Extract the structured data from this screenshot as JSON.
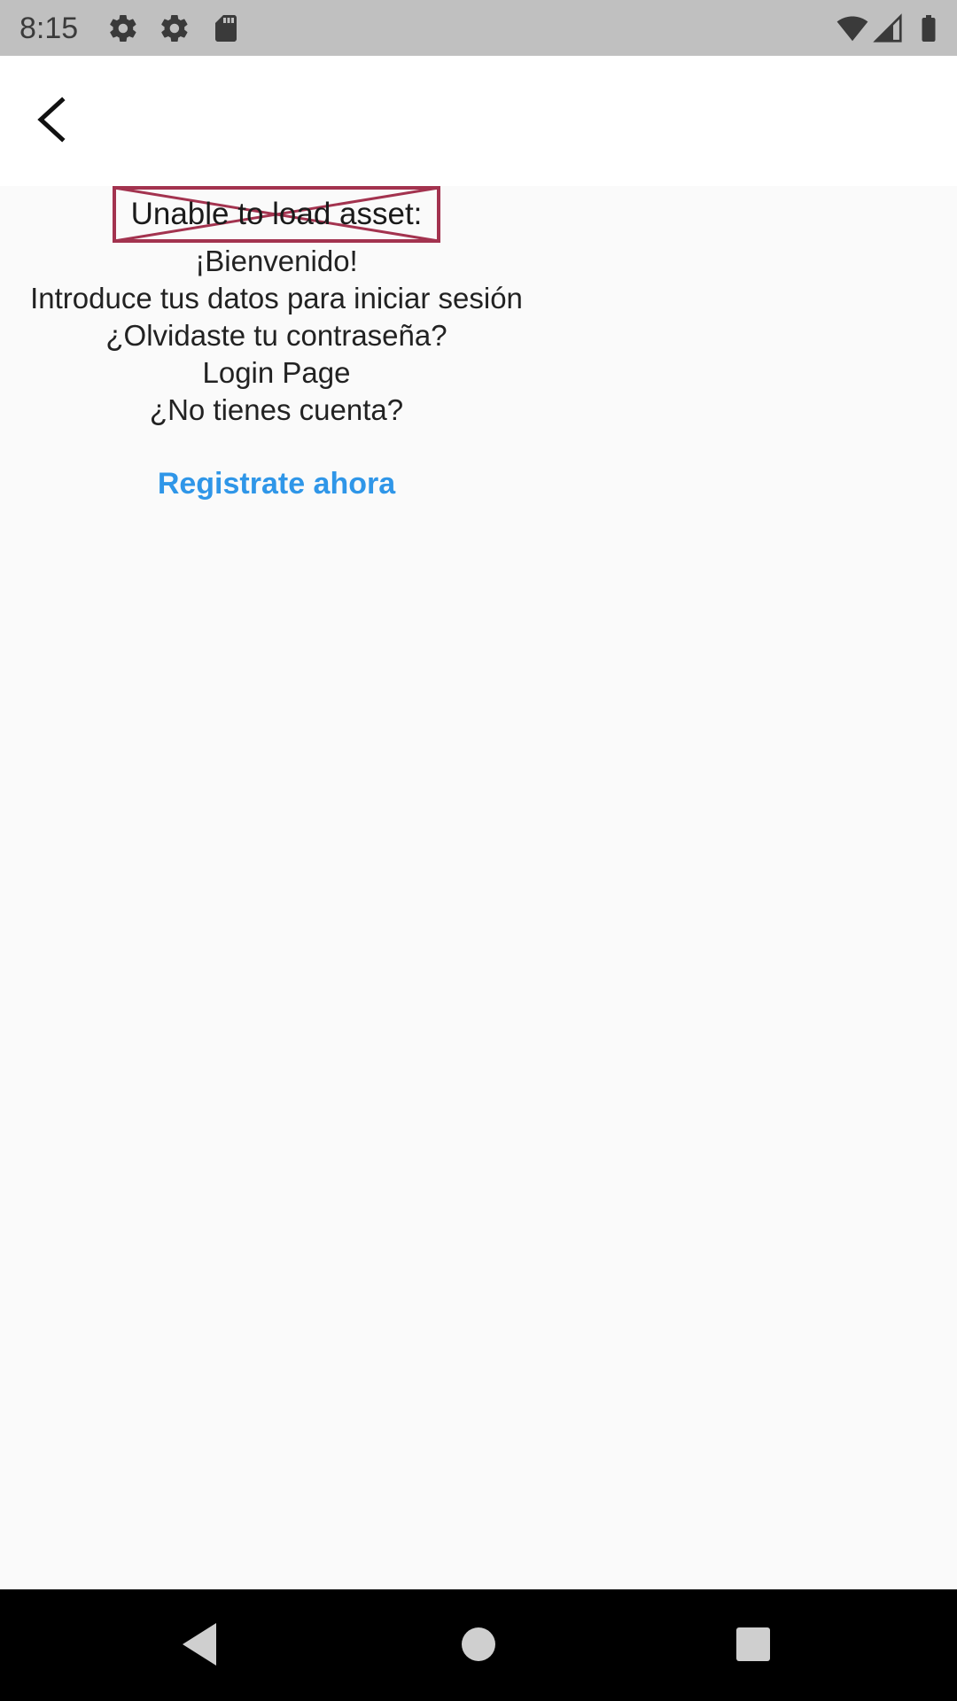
{
  "status_bar": {
    "time": "8:15",
    "icons_left": [
      "gear-icon",
      "gear-icon",
      "sd-card-icon"
    ],
    "icons_right": [
      "wifi-icon",
      "signal-icon",
      "battery-icon"
    ]
  },
  "app_bar": {
    "back_icon": "back-arrow-icon"
  },
  "content": {
    "asset_error": "Unable to load asset:",
    "welcome": "¡Bienvenido!",
    "subtitle": "Introduce tus datos para iniciar sesión",
    "forgot_password": "¿Olvidaste tu contraseña?",
    "page_label": "Login Page",
    "no_account": "¿No tienes cuenta?",
    "register_link": "Registrate ahora"
  },
  "colors": {
    "status_bar": "#c0c0c0",
    "app_bar": "#ffffff",
    "background": "#fafafa",
    "link": "#2f96e8",
    "error_border": "#a3334f",
    "nav_bar": "#000000"
  },
  "nav_bar": {
    "buttons": [
      "back-triangle-icon",
      "home-circle-icon",
      "recents-square-icon"
    ]
  }
}
